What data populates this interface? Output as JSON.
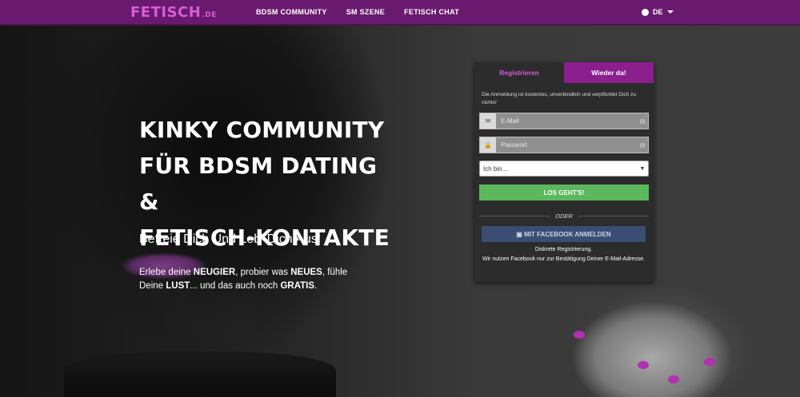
{
  "header": {
    "logo_main": "FETISCH",
    "logo_suffix": ".DE",
    "nav": [
      "BDSM COMMUNITY",
      "SM SZENE",
      "FETISCH CHAT"
    ],
    "language": "DE"
  },
  "hero": {
    "title_lines": [
      "KINKY COMMUNITY",
      "FÜR BDSM DATING &",
      "FETISCH-KONTAKTE"
    ],
    "subtitle": "Befreie Dich Und Leb' Dich Aus!",
    "desc_1": "Erlebe deine ",
    "desc_b1": "NEUGIER",
    "desc_2": ", probier was ",
    "desc_b2": "NEUES",
    "desc_3": ", fühle Deine ",
    "desc_b3": "LUST",
    "desc_4": "... und das auch noch ",
    "desc_b4": "GRATIS",
    "desc_5": "."
  },
  "panel": {
    "tab_register": "Registrieren",
    "tab_login": "Wieder da!",
    "note": "Die Anmeldung ist kostenlos, unverbindlich und verpflichtet Dich zu nichts!",
    "email_placeholder": "E-Mail",
    "password_placeholder": "Passwort",
    "select_value": "Ich bin...",
    "submit_label": "LOS GEHT'S!",
    "or_label": "ODER",
    "facebook_label": "MIT FACEBOOK ANMELDEN",
    "fb_note_1": "Diskrete Registrierung.",
    "fb_note_2": "Wir nutzen Facebook nur zur Bestätigung Deiner E-Mail-Adresse."
  },
  "colors": {
    "brand_purple": "#6a1a6e",
    "accent_pink": "#d55ed6",
    "submit_green": "#5cb85c",
    "facebook_blue": "#3b4d73"
  },
  "icons": {
    "language": "globe-icon",
    "email": "envelope-icon",
    "password": "lock-icon",
    "facebook": "facebook-icon"
  }
}
